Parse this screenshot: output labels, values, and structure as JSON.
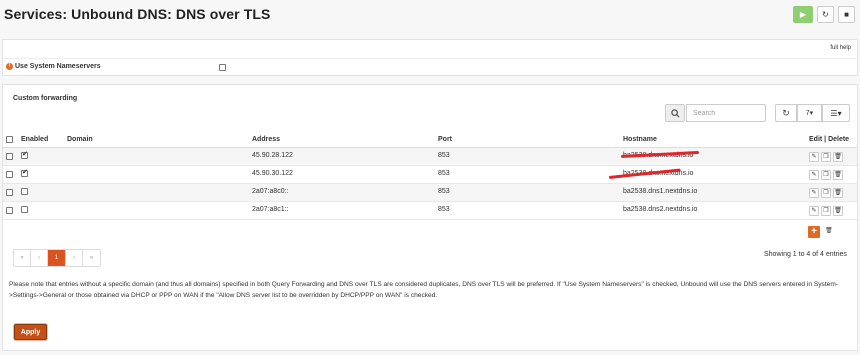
{
  "header": {
    "title": "Services: Unbound DNS: DNS over TLS",
    "play_icon": "▶",
    "restart_icon": "↻",
    "stop_icon": "■"
  },
  "general": {
    "full_help": "full help",
    "use_system_nameservers_label": "Use System Nameservers",
    "use_system_nameservers_checked": false
  },
  "forwarding": {
    "section_title": "Custom forwarding",
    "search": {
      "placeholder": "Search",
      "value": ""
    },
    "rows_per_page": "7▾",
    "columns_icon": "☰▾",
    "columns": {
      "enabled": "Enabled",
      "domain": "Domain",
      "address": "Address",
      "port": "Port",
      "hostname": "Hostname",
      "actions": "Edit | Delete"
    },
    "rows": [
      {
        "enabled": true,
        "domain": "",
        "address": "45.90.28.122",
        "port": "853",
        "hostname": "ba2538.dns.nextdns.io"
      },
      {
        "enabled": true,
        "domain": "",
        "address": "45.90.30.122",
        "port": "853",
        "hostname": "ba2538.dns.nextdns.io"
      },
      {
        "enabled": false,
        "domain": "",
        "address": "2a07:a8c0::",
        "port": "853",
        "hostname": "ba2538.dns1.nextdns.io"
      },
      {
        "enabled": false,
        "domain": "",
        "address": "2a07:a8c1::",
        "port": "853",
        "hostname": "ba2538.dns2.nextdns.io"
      }
    ],
    "pagination": {
      "first": "«",
      "prev": "‹",
      "current": "1",
      "next": "›",
      "last": "»",
      "info": "Showing 1 to 4 of 4 entries"
    }
  },
  "note": "Please note that entries without a specific domain (and thus all domains) specified in both Query Forwarding and DNS over TLS are considered duplicates, DNS over TLS will be preferred. If \"Use System Nameservers\" is checked, Unbound will use the DNS servers entered in System->Settings->General or those obtained via DHCP or PPP on WAN if the \"Allow DNS server list to be overridden by DHCP/PPP on WAN\" is checked.",
  "apply_label": "Apply",
  "colors": {
    "accent": "#d9541e",
    "apply": "#c35117",
    "play": "#8fcf72",
    "redaction": "#e0262a"
  }
}
